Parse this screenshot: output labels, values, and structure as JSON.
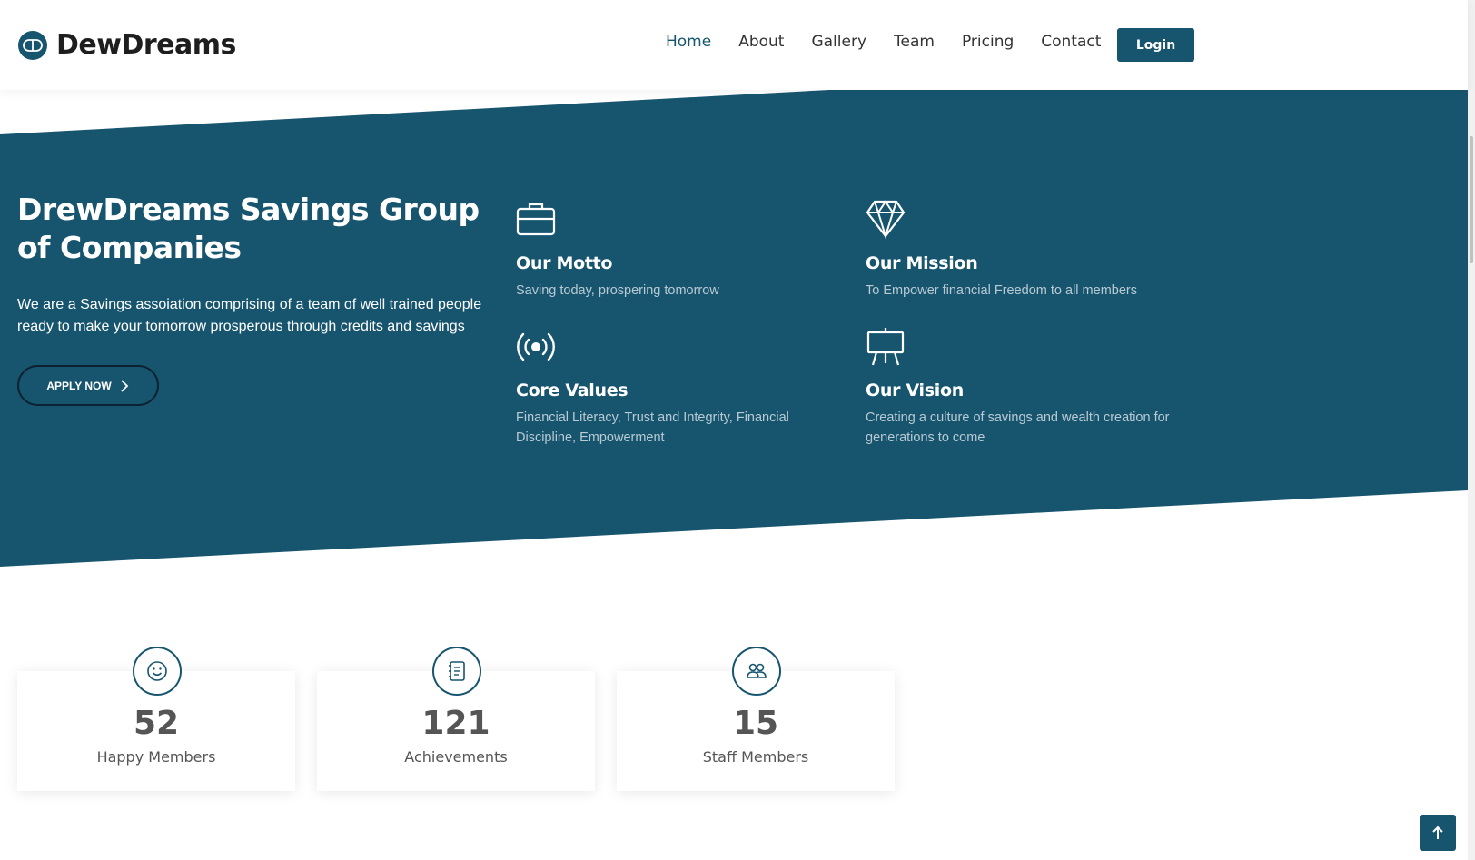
{
  "brand": {
    "name": "DewDreams"
  },
  "nav": {
    "items": [
      "Home",
      "About",
      "Gallery",
      "Team",
      "Pricing",
      "Contact"
    ],
    "active": "Home",
    "login_label": "Login"
  },
  "hero": {
    "title": "DrewDreams Savings Group of Companies",
    "description": "We are a Savings assoiation comprising of a team of well trained people ready to make your tomorrow prosperous through credits and savings",
    "apply_label": "APPLY NOW"
  },
  "features": [
    {
      "icon": "briefcase-icon",
      "title": "Our Motto",
      "text": "Saving today, prospering tomorrow"
    },
    {
      "icon": "diamond-icon",
      "title": "Our Mission",
      "text": "To Empower financial Freedom to all members"
    },
    {
      "icon": "broadcast-icon",
      "title": "Core Values",
      "text": "Financial Literacy, Trust and Integrity, Financial Discipline, Empowerment"
    },
    {
      "icon": "easel-icon",
      "title": "Our Vision",
      "text": "Creating a culture of savings and wealth creation for generations to come"
    }
  ],
  "stats": [
    {
      "icon": "smiley-icon",
      "value": "52",
      "label": "Happy Members"
    },
    {
      "icon": "journal-icon",
      "value": "121",
      "label": "Achievements"
    },
    {
      "icon": "people-icon",
      "value": "15",
      "label": "Staff Members"
    }
  ],
  "colors": {
    "primary": "#17556f",
    "hero_text_muted": "#b9cad3"
  }
}
